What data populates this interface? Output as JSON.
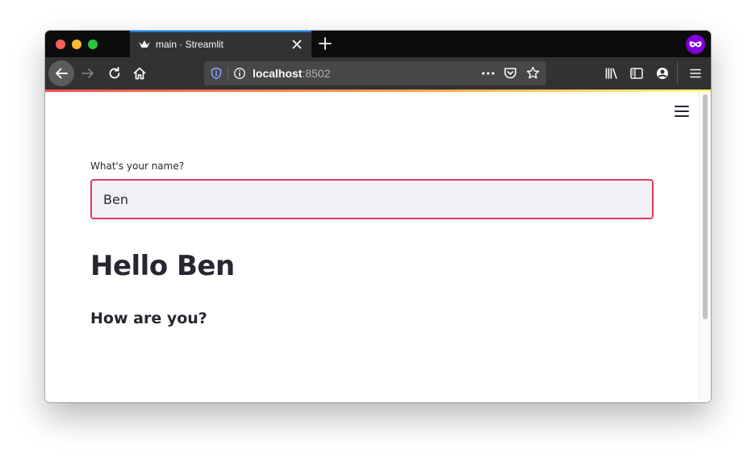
{
  "browser": {
    "tab_title": "main · Streamlit",
    "url_host": "localhost",
    "url_port": ":8502"
  },
  "app": {
    "input_label": "What's your name?",
    "input_value": "Ben",
    "heading": "Hello Ben",
    "subheading": "How are you?"
  },
  "icons": [
    "close-icon",
    "new-tab-icon",
    "private-browsing-icon",
    "back-icon",
    "forward-icon",
    "reload-icon",
    "home-icon",
    "shield-icon",
    "info-icon",
    "more-icon",
    "pocket-icon",
    "bookmark-star-icon",
    "library-icon",
    "sidebar-icon",
    "account-icon",
    "menu-icon",
    "streamlit-logo-icon"
  ],
  "colors": {
    "input_focus_border": "#e03a5f",
    "private_badge": "#8000d7",
    "tab_accent": "#0a84ff"
  }
}
